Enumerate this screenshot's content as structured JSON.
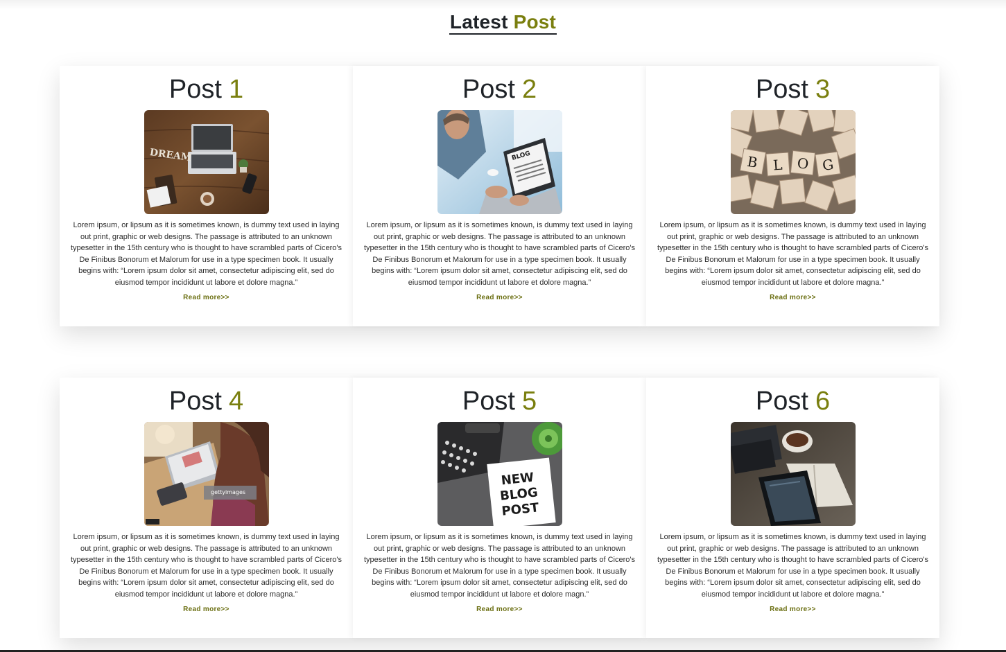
{
  "section": {
    "title_main": "Latest",
    "title_accent": "Post"
  },
  "colors": {
    "accent": "#7a7f0f",
    "text_dark": "#1f2328"
  },
  "posts": [
    {
      "label": "Post",
      "number": "1",
      "image_icon": "laptop-desk-dream-image",
      "text": "Lorem ipsum, or lipsum as it is sometimes known, is dummy text used in laying out print, graphic or web designs. The passage is attributed to an unknown typesetter in the 15th century who is thought to have scrambled parts of Cicero's De Finibus Bonorum et Malorum for use in a type specimen book. It usually begins with: “Lorem ipsum dolor sit amet, consectetur adipiscing elit, sed do eiusmod tempor incididunt ut labore et dolore magna.”",
      "read_more": "Read more>>"
    },
    {
      "label": "Post",
      "number": "2",
      "image_icon": "blog-laptop-image",
      "text": "Lorem ipsum, or lipsum as it is sometimes known, is dummy text used in laying out print, graphic or web designs. The passage is attributed to an unknown typesetter in the 15th century who is thought to have scrambled parts of Cicero's De Finibus Bonorum et Malorum for use in a type specimen book. It usually begins with: “Lorem ipsum dolor sit amet, consectetur adipiscing elit, sed do eiusmod tempor incididunt ut labore et dolore magna.”",
      "read_more": "Read more>>"
    },
    {
      "label": "Post",
      "number": "3",
      "image_icon": "blog-scrabble-tiles-image",
      "text": "Lorem ipsum, or lipsum as it is sometimes known, is dummy text used in laying out print, graphic or web designs. The passage is attributed to an unknown typesetter in the 15th century who is thought to have scrambled parts of Cicero's De Finibus Bonorum et Malorum for use in a type specimen book. It usually begins with: “Lorem ipsum dolor sit amet, consectetur adipiscing elit, sed do eiusmod tempor incididunt ut labore et dolore magna.”",
      "read_more": "Read more>>"
    },
    {
      "label": "Post",
      "number": "4",
      "image_icon": "woman-laptop-image",
      "text": "Lorem ipsum, or lipsum as it is sometimes known, is dummy text used in laying out print, graphic or web designs. The passage is attributed to an unknown typesetter in the 15th century who is thought to have scrambled parts of Cicero's De Finibus Bonorum et Malorum for use in a type specimen book. It usually begins with: “Lorem ipsum dolor sit amet, consectetur adipiscing elit, sed do eiusmod tempor incididunt ut labore et dolore magna.”",
      "read_more": "Read more>>"
    },
    {
      "label": "Post",
      "number": "5",
      "image_icon": "new-blog-post-typewriter-image",
      "image_text": [
        "NEW",
        "BLOG",
        "POST"
      ],
      "text": "Lorem ipsum, or lipsum as it is sometimes known, is dummy text used in laying out print, graphic or web designs. The passage is attributed to an unknown typesetter in the 15th century who is thought to have scrambled parts of Cicero's De Finibus Bonorum et Malorum for use in a type specimen book. It usually begins with: “Lorem ipsum dolor sit amet, consectetur adipiscing elit, sed do eiusmod tempor incididunt ut labore et dolore magn.”",
      "read_more": "Read more>>"
    },
    {
      "label": "Post",
      "number": "6",
      "image_icon": "tablet-coffee-notebook-image",
      "text": "Lorem ipsum, or lipsum as it is sometimes known, is dummy text used in laying out print, graphic or web designs. The passage is attributed to an unknown typesetter in the 15th century who is thought to have scrambled parts of Cicero's De Finibus Bonorum et Malorum for use in a type specimen book. It usually begins with: “Lorem ipsum dolor sit amet, consectetur adipiscing elit, sed do eiusmod tempor incididunt ut labore et dolore magna.”",
      "read_more": "Read more>>"
    }
  ]
}
